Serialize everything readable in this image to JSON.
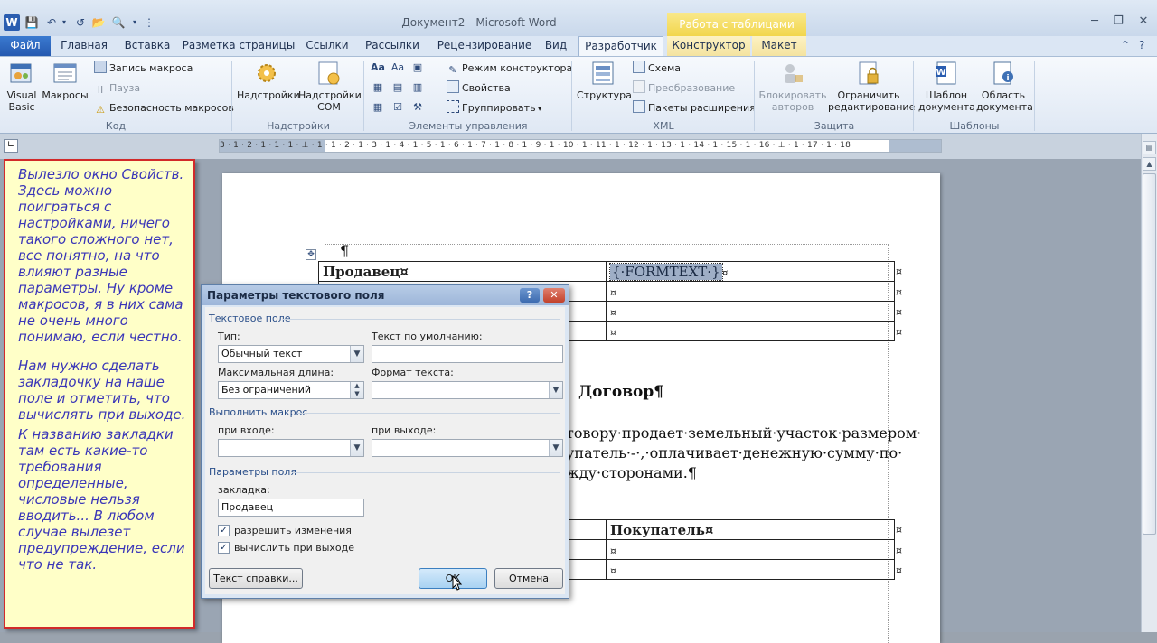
{
  "window": {
    "title": "Документ2 - Microsoft Word",
    "context_title": "Работа с таблицами",
    "word_logo": "W"
  },
  "tabs": {
    "file": "Файл",
    "home": "Главная",
    "insert": "Вставка",
    "page_layout": "Разметка страницы",
    "references": "Ссылки",
    "mailings": "Рассылки",
    "review": "Рецензирование",
    "view": "Вид",
    "developer": "Разработчик",
    "constructor": "Конструктор",
    "layout": "Макет"
  },
  "ribbon": {
    "code": {
      "label": "Код",
      "visual_basic": "Visual Basic",
      "macros": "Макросы",
      "record_macro": "Запись макроса",
      "pause": "Пауза",
      "macro_security": "Безопасность макросов"
    },
    "addins": {
      "label": "Надстройки",
      "addins": "Надстройки",
      "com_addins_1": "Надстройки",
      "com_addins_2": "COM"
    },
    "controls": {
      "label": "Элементы управления",
      "design_mode": "Режим конструктора",
      "properties": "Свойства",
      "group": "Группировать"
    },
    "xml": {
      "label": "XML",
      "structure": "Структура",
      "schema": "Схема",
      "transform": "Преобразование",
      "expansion_packs": "Пакеты расширения"
    },
    "protect": {
      "label": "Защита",
      "block_authors_1": "Блокировать",
      "block_authors_2": "авторов",
      "restrict_1": "Ограничить",
      "restrict_2": "редактирование"
    },
    "templates": {
      "label": "Шаблоны",
      "doc_template_1": "Шаблон",
      "doc_template_2": "документа",
      "doc_area_1": "Область",
      "doc_area_2": "документа"
    }
  },
  "ruler": {
    "text": "3 · 1 · 2 · 1 · 1 · 1 · ⊥ · 1 · 1 · 2 · 1 · 3 · 1 · 4 · 1 · 5 · 1 · 6 · 1 · 7 · 1 · 8 · 1 · 9 · 1 · 10 · 1 · 11 · 1 · 12 · 1 · 13 · 1 · 14 · 1 · 15 · 1 · 16 · ⊥ · 1 · 17 · 1 · 18"
  },
  "note": {
    "p1": "Вылезло окно Свойств. Здесь можно поиграться с настройками, ничего такого сложного нет, все понятно, на что влияют разные параметры. Ну кроме макросов, я в них сама не очень много понимаю, если честно.",
    "p2": "Нам нужно сделать закладочку на наше поле и отметить, что вычислять при выходе.",
    "p3": "К названию закладки там есть какие-то требования определенные, числовые нельзя вводить... В любом случае вылезет предупреждение, если что не так."
  },
  "document": {
    "pilcrow": "¶",
    "seller": "Продавец¤",
    "formtext": "{·FORMTEXT·}",
    "cell_mark": "¤",
    "heading": "Договор¶",
    "line1": "товору·продает·земельный·участок·размером·",
    "line2": "упатель·-·,·оплачивает·денежную·сумму·по·",
    "line3": "жду·сторонами.¶",
    "buyer": "Покупатель¤"
  },
  "dialog": {
    "title": "Параметры текстового поля",
    "help_icon": "?",
    "close_icon": "✕",
    "section_textfield": "Текстовое поле",
    "type_label": "Тип:",
    "type_value": "Обычный текст",
    "default_label": "Текст по умолчанию:",
    "default_value": "",
    "maxlen_label": "Максимальная длина:",
    "maxlen_value": "Без ограничений",
    "format_label": "Формат текста:",
    "format_value": "",
    "section_macro": "Выполнить макрос",
    "on_entry_label": "при входе:",
    "on_exit_label": "при выходе:",
    "section_field": "Параметры поля",
    "bookmark_label": "закладка:",
    "bookmark_value": "Продавец",
    "allow_changes": "разрешить изменения",
    "allow_changes_checked": true,
    "calc_on_exit": "вычислить при выходе",
    "calc_on_exit_checked": true,
    "help_text_button": "Текст справки...",
    "ok_button": "ОК",
    "cancel_button": "Отмена"
  },
  "colors": {
    "accent": "#2559b0",
    "note_border": "#d22a2a",
    "note_text": "#3a36b8"
  }
}
